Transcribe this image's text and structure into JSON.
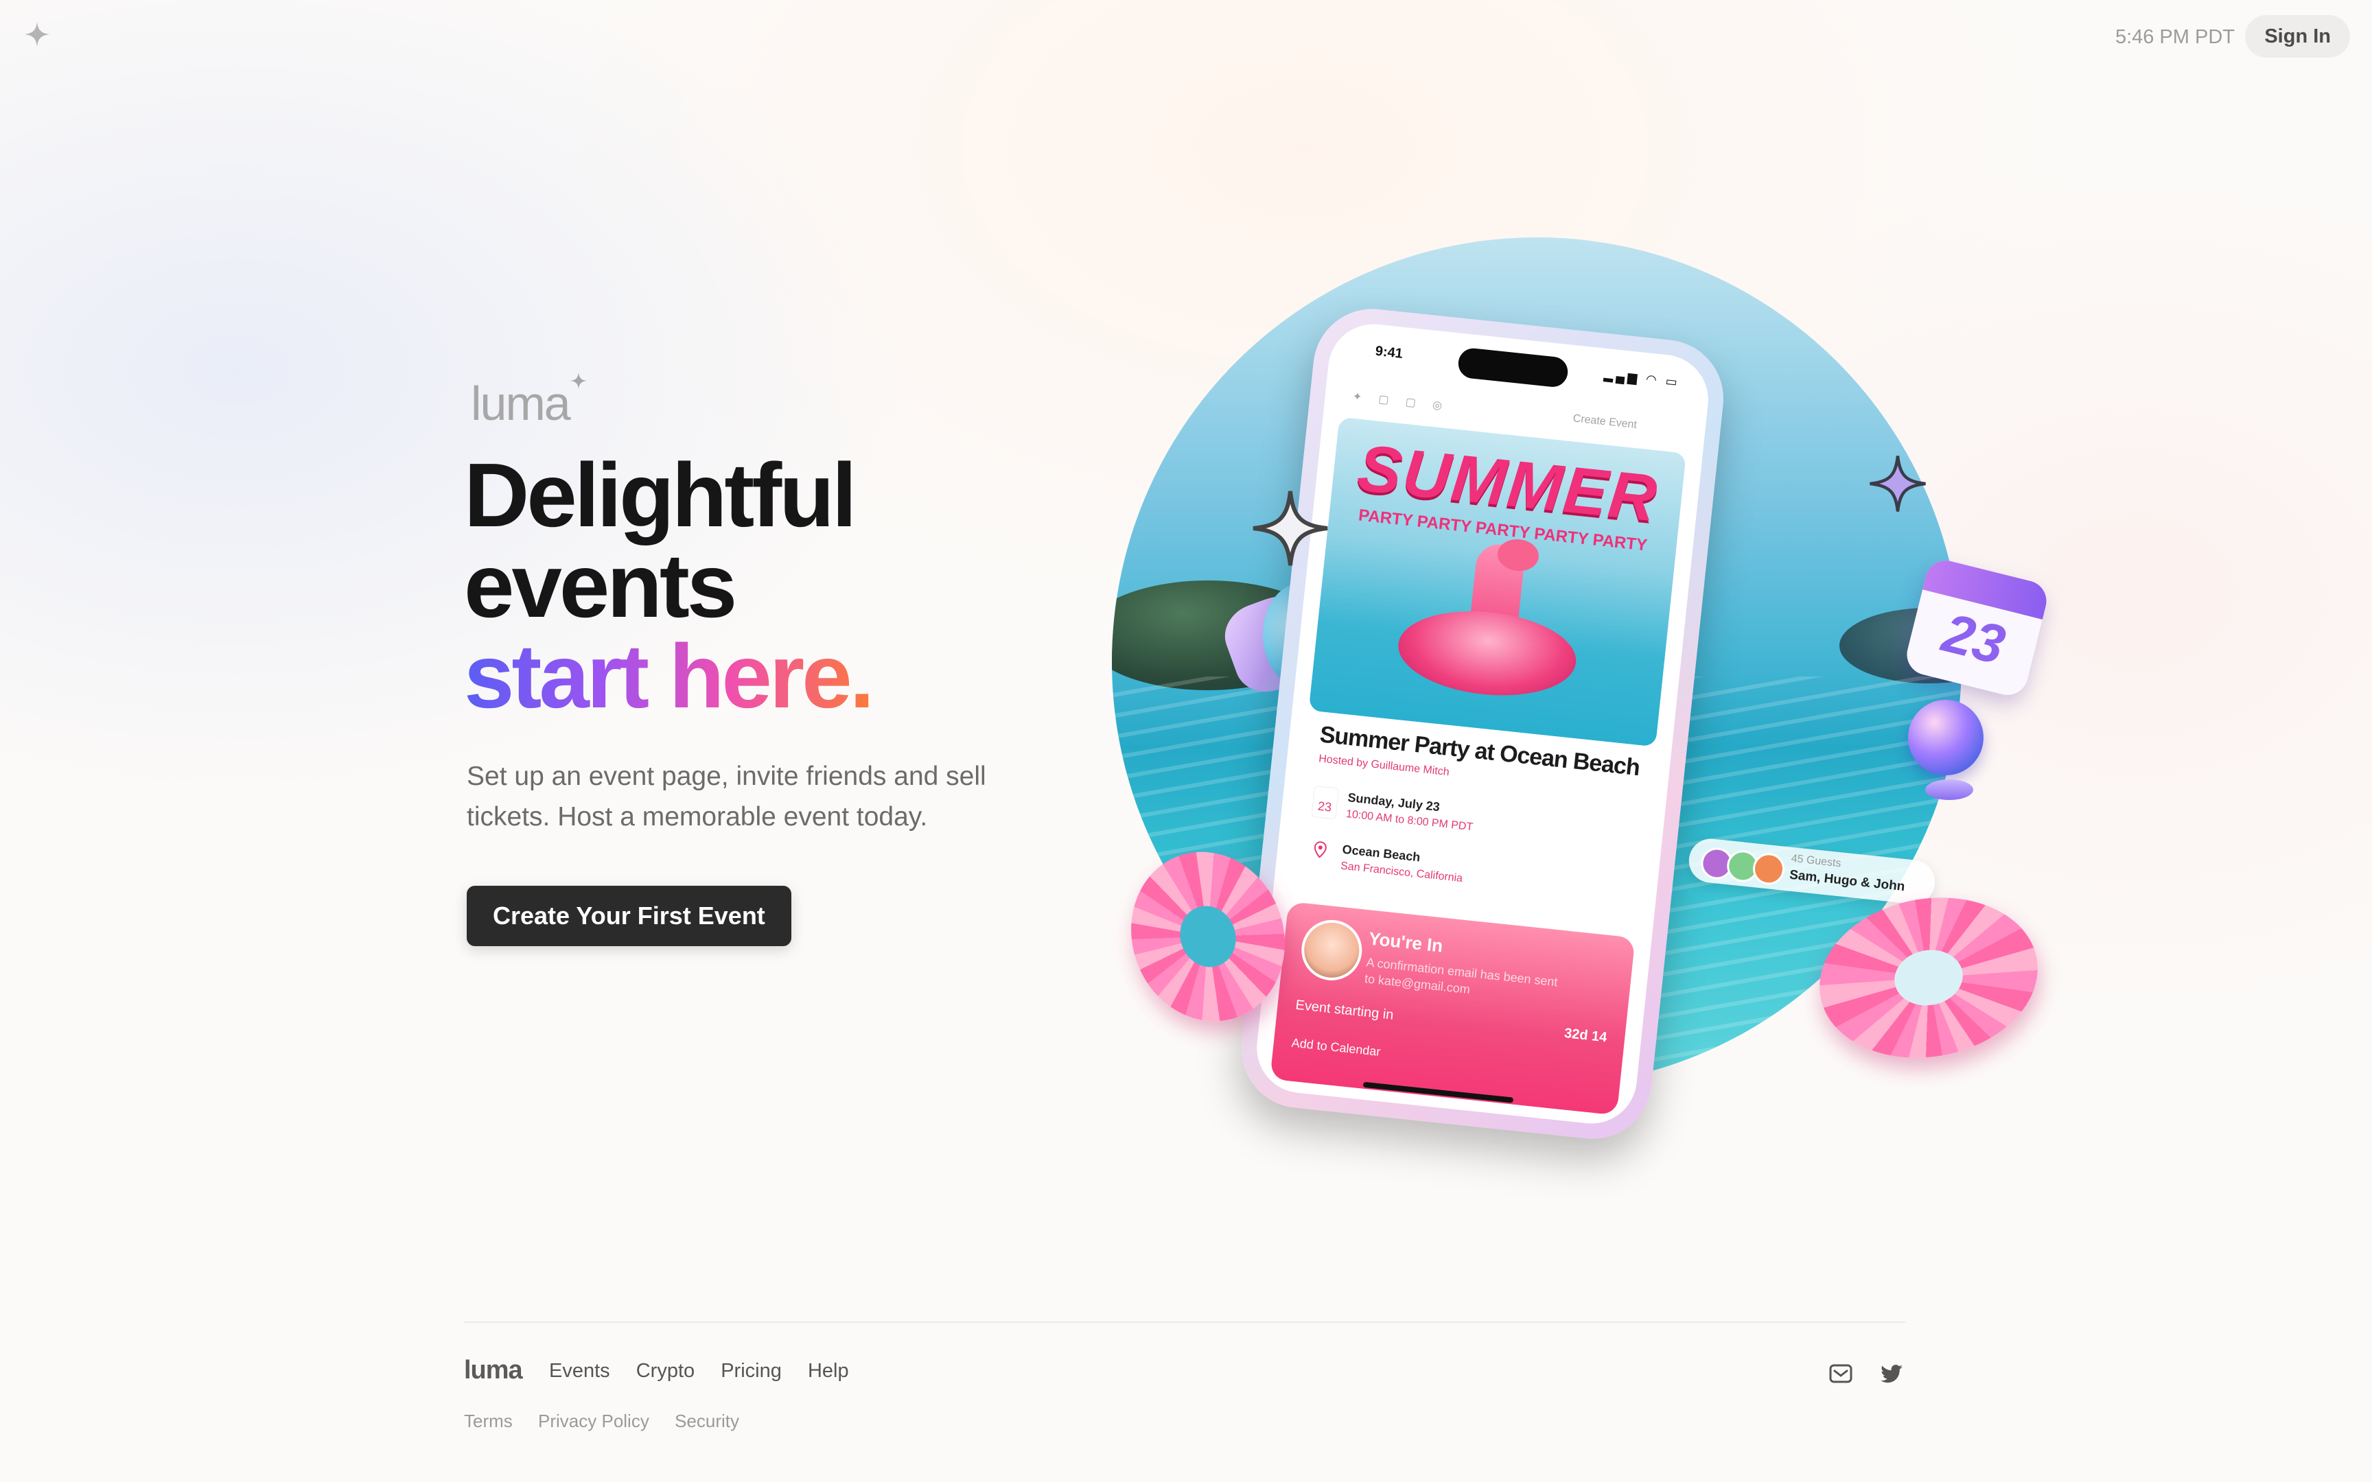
{
  "topbar": {
    "logo_icon": "luma-sparkle-icon",
    "time": "5:46 PM PDT",
    "sign_in_label": "Sign In"
  },
  "hero": {
    "brand": "luma",
    "headline_line1": "Delightful",
    "headline_line2": "events",
    "headline_line3": "start here.",
    "subtitle": "Set up an event page, invite friends and sell tickets. Host a memorable event today.",
    "cta_label": "Create Your First Event"
  },
  "phone": {
    "status_time": "9:41",
    "appbar_create": "Create Event",
    "poster_title": "SUMMER",
    "poster_subtitle": "PARTY PARTY PARTY PARTY PARTY",
    "event_title": "Summer Party at Ocean Beach",
    "event_host": "Hosted by Guillaume Mitch",
    "calendar_day": "23",
    "event_date": "Sunday, July 23",
    "event_time": "10:00 AM to 8:00 PM PDT",
    "event_location": "Ocean Beach",
    "event_location_detail": "San Francisco, California",
    "guests_count": "45 Guests",
    "guests_names": "Sam, Hugo & John",
    "rsvp_title": "You're In",
    "rsvp_message": "A confirmation email has been sent to kate@gmail.com",
    "countdown_label": "Event starting in",
    "countdown_value": "32d 14",
    "add_to_calendar": "Add to Calendar",
    "calendar_sticker_number": "23"
  },
  "footer": {
    "logo": "luma",
    "nav": [
      "Events",
      "Crypto",
      "Pricing",
      "Help"
    ],
    "legal": [
      "Terms",
      "Privacy Policy",
      "Security"
    ],
    "social_icons": [
      "email-icon",
      "twitter-icon"
    ]
  },
  "colors": {
    "gradient_start": "#5b5ef4",
    "gradient_mid": "#ef4fb0",
    "gradient_end": "#fb7a3c",
    "cta_bg": "#2b2b2c",
    "accent_pink": "#f0307a"
  }
}
